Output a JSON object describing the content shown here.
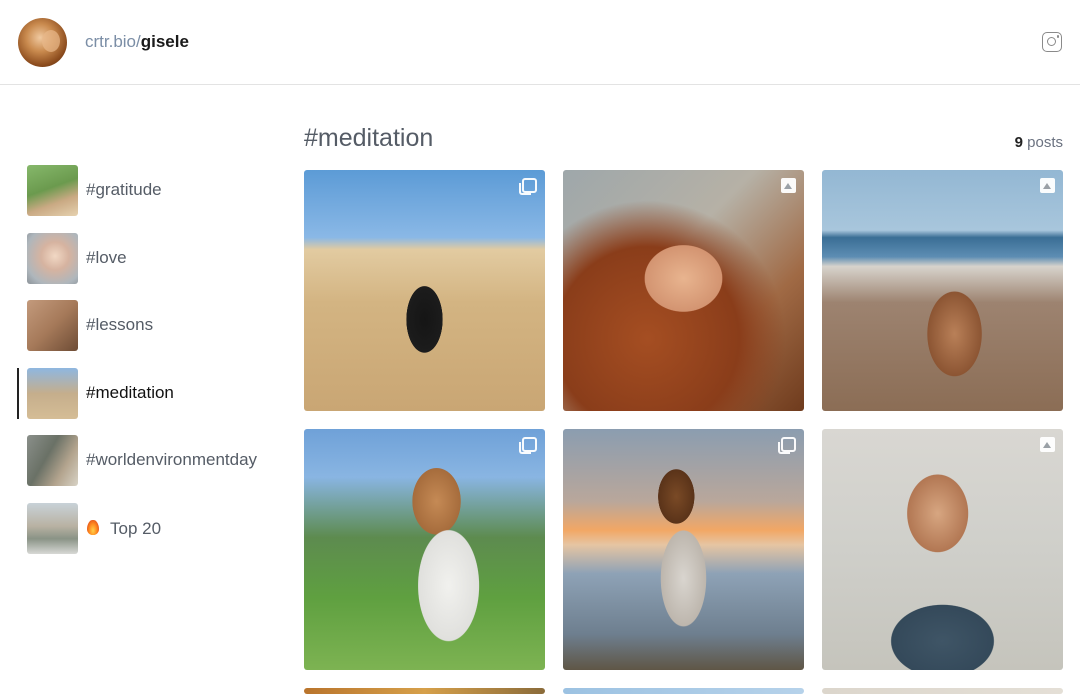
{
  "header": {
    "domain_text": "crtr.bio/",
    "username": "gisele",
    "instagram_icon": "instagram-icon"
  },
  "sidebar": {
    "items": [
      {
        "label": "#gratitude",
        "active": false
      },
      {
        "label": "#love",
        "active": false
      },
      {
        "label": "#lessons",
        "active": false
      },
      {
        "label": "#meditation",
        "active": true
      },
      {
        "label": "#worldenvironmentday",
        "active": false
      },
      {
        "label": "Top 20",
        "icon": "fire-icon",
        "active": false
      }
    ]
  },
  "main": {
    "title": "#meditation",
    "post_count": "9",
    "post_count_suffix": " posts",
    "posts": [
      {
        "icon": "album-icon"
      },
      {
        "icon": "image-icon"
      },
      {
        "icon": "image-icon"
      },
      {
        "icon": "album-icon"
      },
      {
        "icon": "album-icon"
      },
      {
        "icon": "image-icon"
      },
      {
        "icon": ""
      },
      {
        "icon": ""
      },
      {
        "icon": ""
      }
    ]
  }
}
